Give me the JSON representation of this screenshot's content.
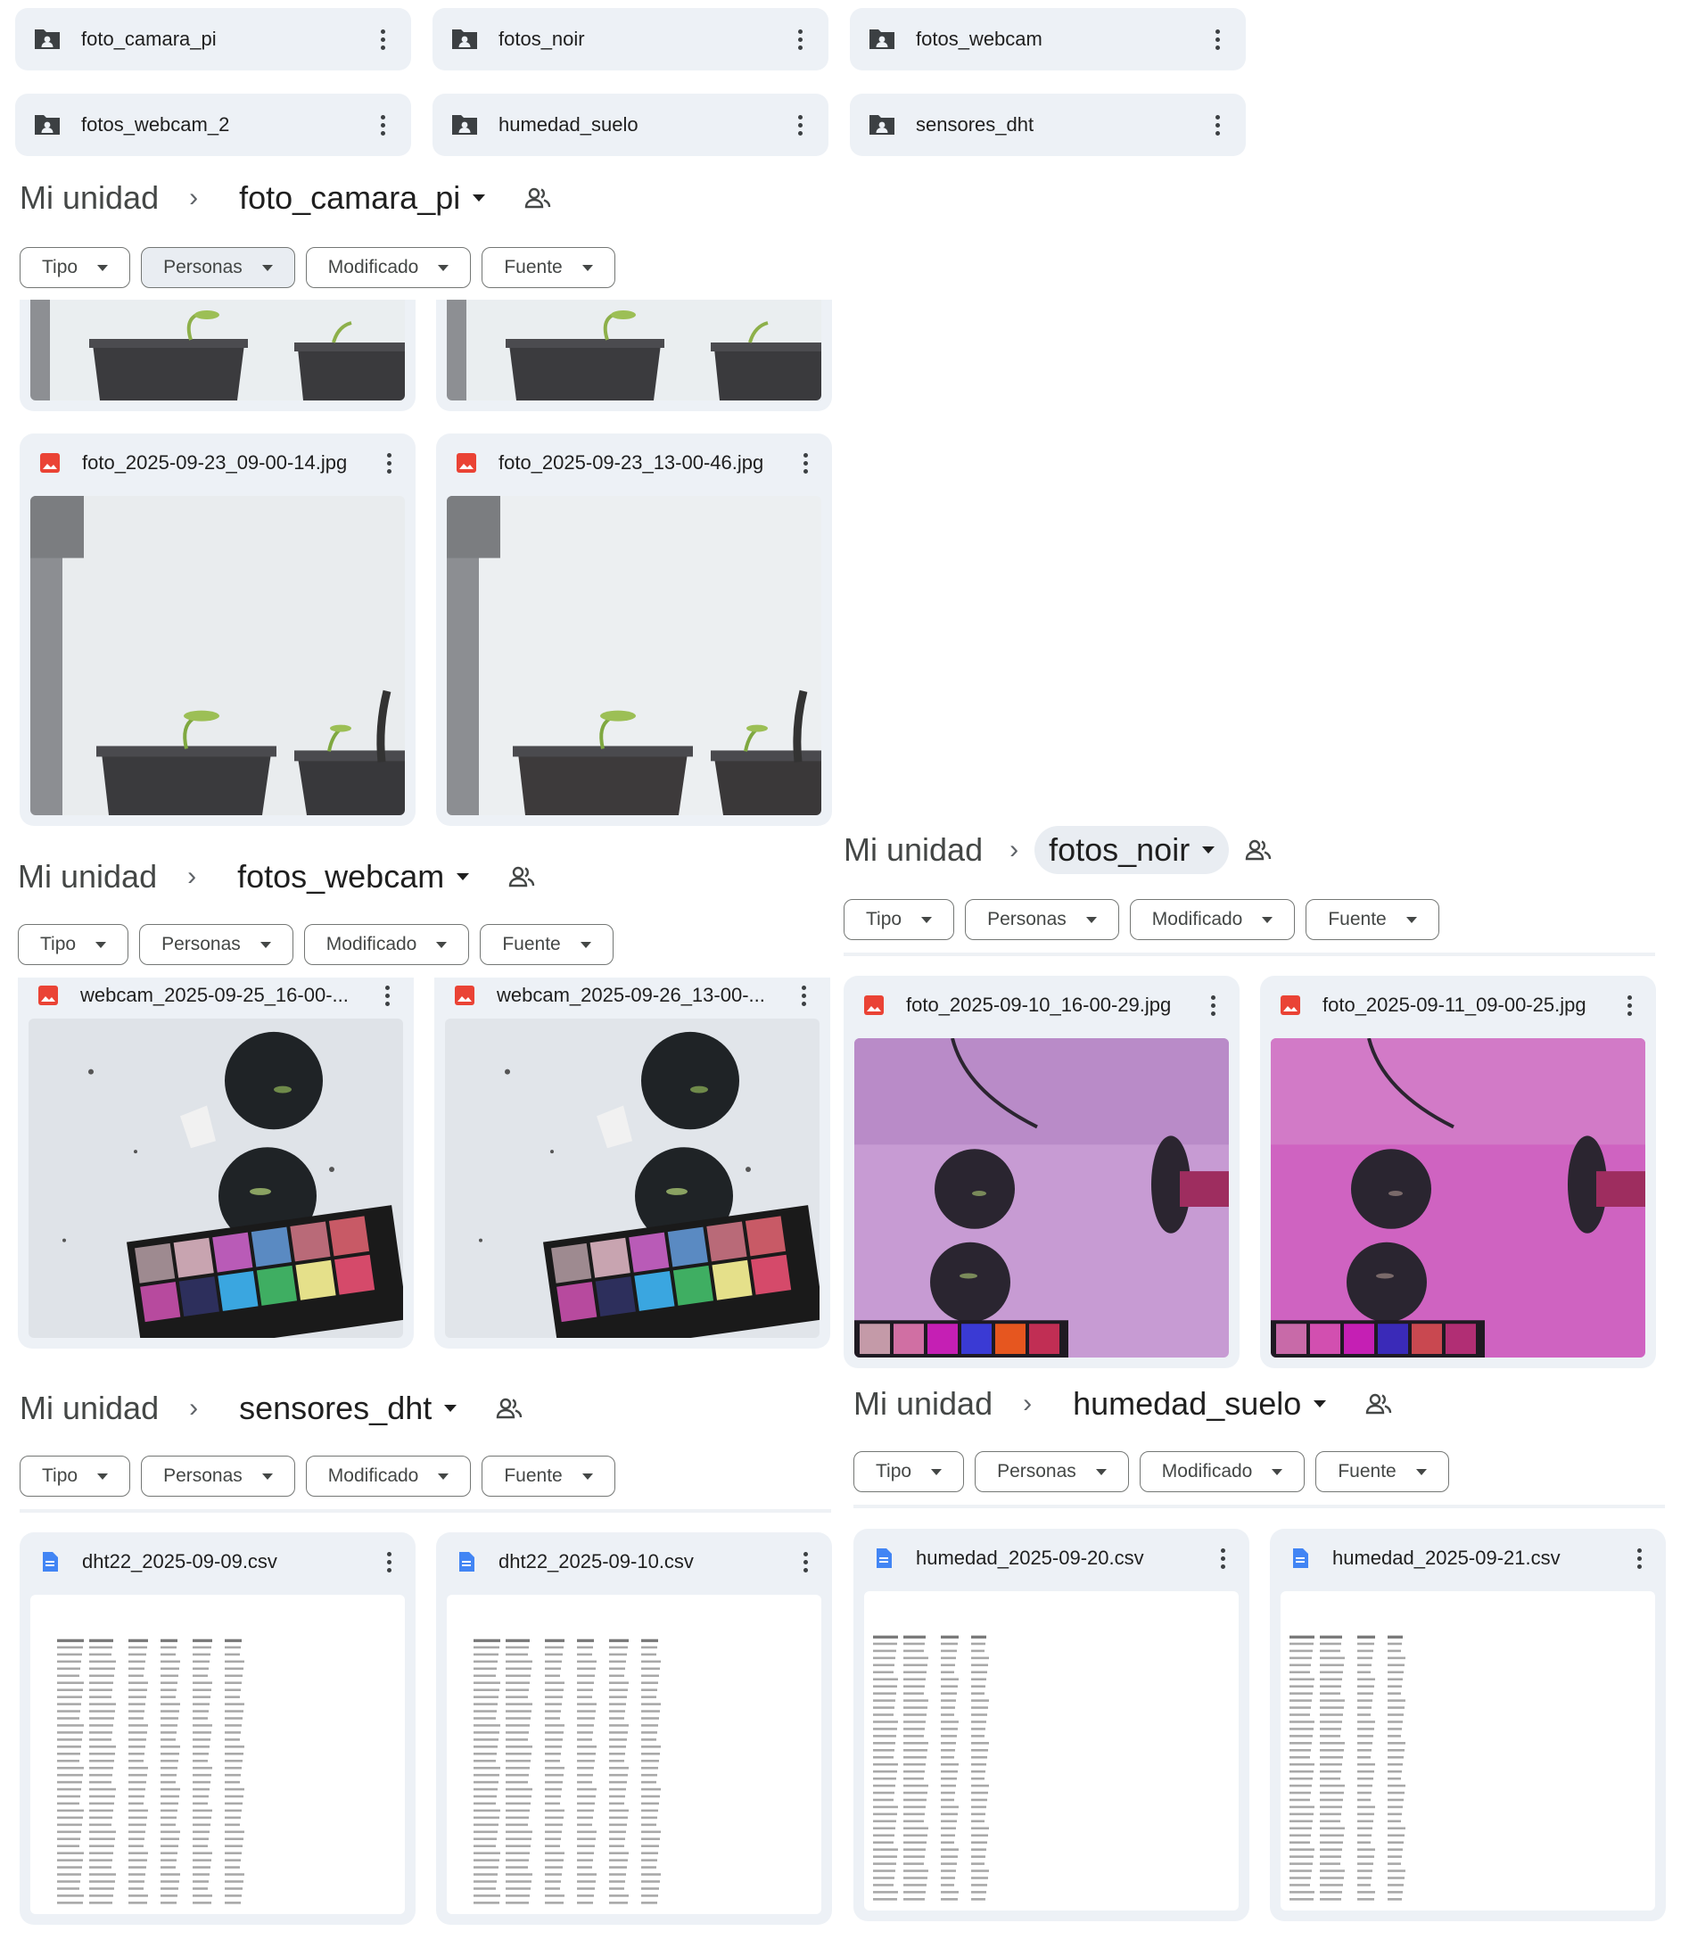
{
  "folders": [
    {
      "name": "foto_camara_pi"
    },
    {
      "name": "fotos_noir"
    },
    {
      "name": "fotos_webcam"
    },
    {
      "name": "fotos_webcam_2"
    },
    {
      "name": "humedad_suelo"
    },
    {
      "name": "sensores_dht"
    }
  ],
  "breadcrumb_root": "Mi unidad",
  "filters": {
    "tipo": "Tipo",
    "personas": "Personas",
    "modificado": "Modificado",
    "fuente": "Fuente"
  },
  "panels": {
    "camara_pi": {
      "folder": "foto_camara_pi",
      "files": [
        "foto_2025-09-23_09-00-14.jpg",
        "foto_2025-09-23_13-00-46.jpg"
      ]
    },
    "webcam": {
      "folder": "fotos_webcam",
      "files": [
        "webcam_2025-09-25_16-00-...",
        "webcam_2025-09-26_13-00-..."
      ]
    },
    "noir": {
      "folder": "fotos_noir",
      "files": [
        "foto_2025-09-10_16-00-29.jpg",
        "foto_2025-09-11_09-00-25.jpg"
      ]
    },
    "dht": {
      "folder": "sensores_dht",
      "files": [
        "dht22_2025-09-09.csv",
        "dht22_2025-09-10.csv"
      ]
    },
    "humedad": {
      "folder": "humedad_suelo",
      "files": [
        "humedad_2025-09-20.csv",
        "humedad_2025-09-21.csv"
      ]
    }
  },
  "colors": {
    "image_icon": "#ea4335",
    "doc_icon": "#4285f4",
    "chip_bg": "#edf1f6"
  }
}
